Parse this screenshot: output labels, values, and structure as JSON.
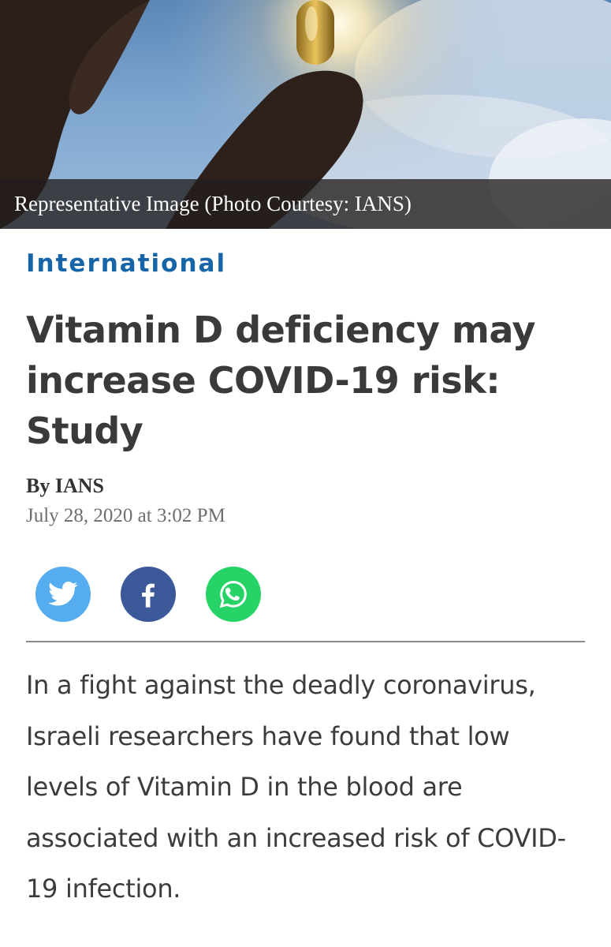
{
  "hero": {
    "caption": "Representative Image (Photo Courtesy: IANS)"
  },
  "article": {
    "category": "International",
    "headline": "Vitamin D deficiency may increase COVID-19 risk: Study",
    "byline": "By IANS",
    "date": "July 28, 2020 at 3:02 PM",
    "body": "In a fight against the deadly coronavirus, Israeli researchers have found that low levels of Vitamin D in the blood are associated with an increased risk of COVID-19 infection."
  },
  "share": {
    "buttons": [
      {
        "icon": "twitter-icon",
        "color": "#55acee"
      },
      {
        "icon": "facebook-icon",
        "color": "#3b5998"
      },
      {
        "icon": "whatsapp-icon",
        "color": "#25d366"
      }
    ]
  },
  "colors": {
    "category": "#1565a8",
    "headline": "#3a3a3a",
    "body": "#3c3c3c",
    "divider": "#8a8a8a"
  }
}
